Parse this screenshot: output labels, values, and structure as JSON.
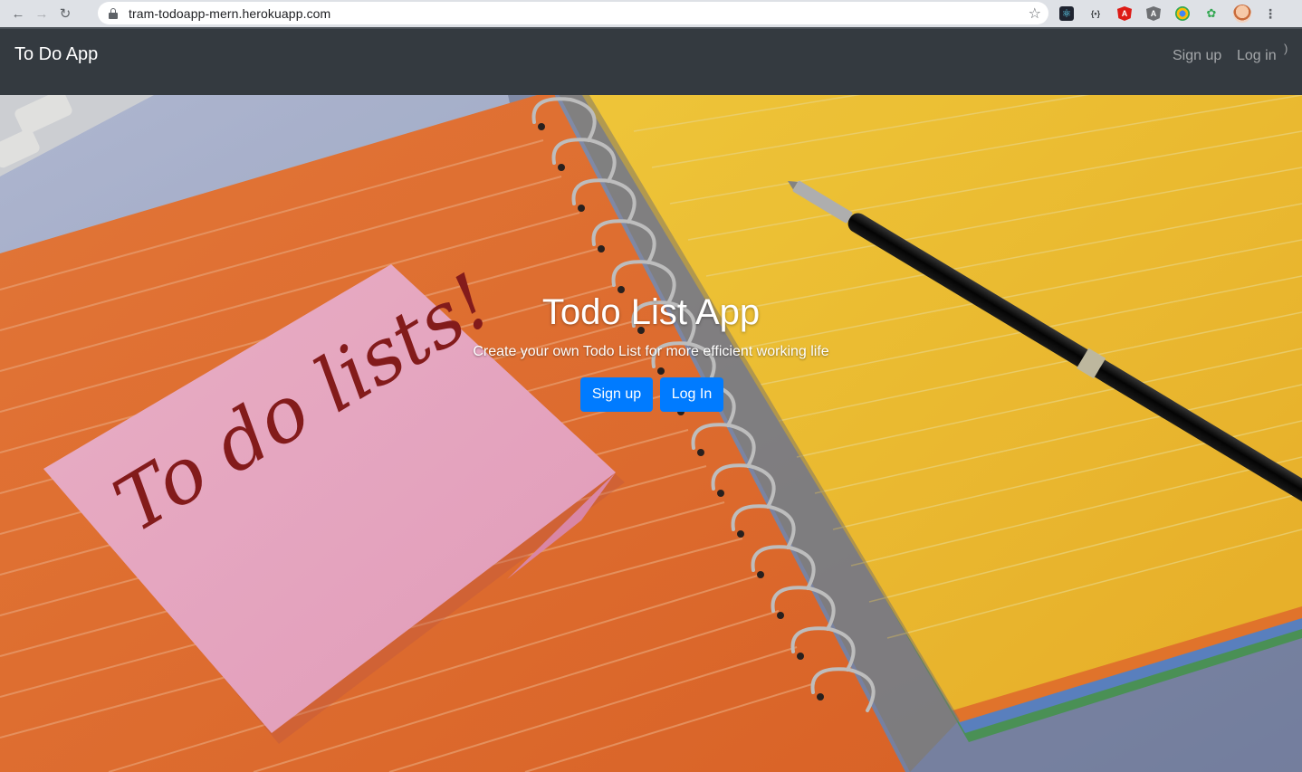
{
  "browser": {
    "url": "tram-todoapp-mern.herokuapp.com",
    "extensions": [
      "react-devtools-icon",
      "redux-devtools-icon",
      "angular-icon",
      "angular-inspector-icon",
      "chrome-color-icon",
      "leaf-extension-icon"
    ]
  },
  "navbar": {
    "brand": "To Do App",
    "signup_label": "Sign up",
    "login_label": "Log in",
    "background": "#343a40"
  },
  "hero": {
    "title": "Todo List App",
    "subtitle": "Create your own Todo List for more efficient working life",
    "signup_button": "Sign up",
    "login_button": "Log In",
    "button_color": "#007bff",
    "sticky_note_text": "To do lists!"
  }
}
